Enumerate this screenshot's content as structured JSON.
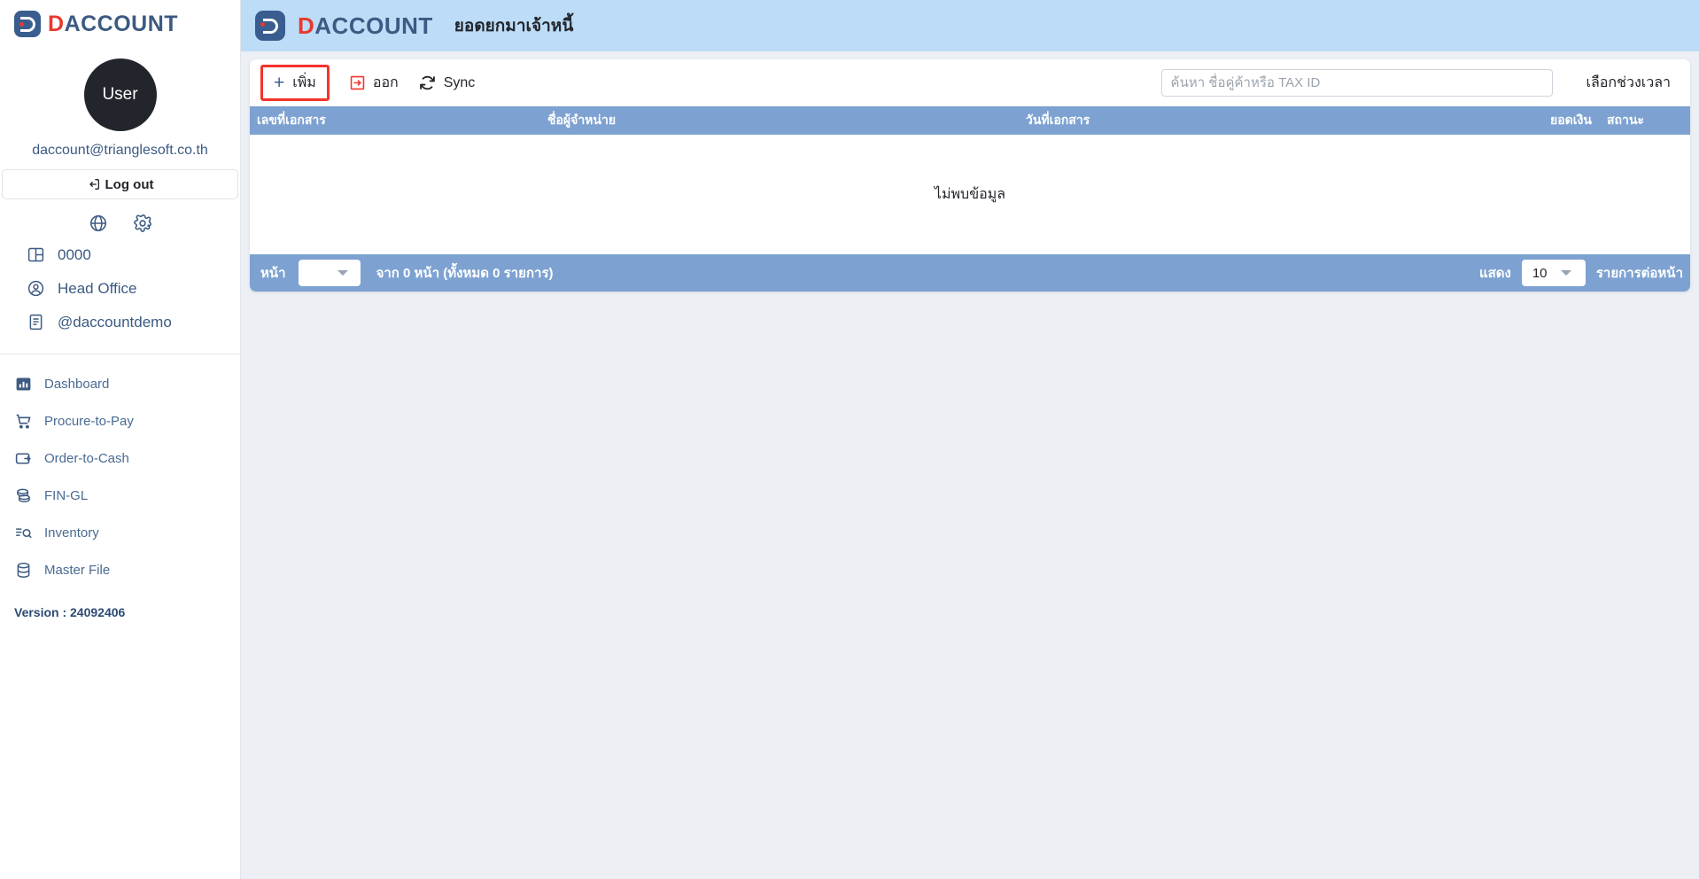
{
  "brand": {
    "name_prefix": "D",
    "name_rest": "ACCOUNT",
    "logo_icon": "daccount-logo-icon"
  },
  "sidebar": {
    "avatar_label": "User",
    "email": "daccount@trianglesoft.co.th",
    "logout_label": "Log out",
    "quick_icons": [
      {
        "name": "globe-icon",
        "label": "globe"
      },
      {
        "name": "gear-icon",
        "label": "settings"
      }
    ],
    "context_items": [
      {
        "label": "0000",
        "icon": "company-panel-icon"
      },
      {
        "label": "Head Office",
        "icon": "user-circle-icon"
      },
      {
        "label": "@daccountdemo",
        "icon": "document-icon"
      }
    ],
    "nav_items": [
      {
        "label": "Dashboard",
        "icon": "chart-bar-icon"
      },
      {
        "label": "Procure-to-Pay",
        "icon": "shopping-cart-icon"
      },
      {
        "label": "Order-to-Cash",
        "icon": "wallet-arrow-icon"
      },
      {
        "label": "FIN-GL",
        "icon": "coins-stack-icon"
      },
      {
        "label": "Inventory",
        "icon": "list-search-icon"
      },
      {
        "label": "Master File",
        "icon": "database-icon"
      }
    ],
    "version": "Version : 24092406"
  },
  "header": {
    "page_title": "ยอดยกมาเจ้าหนี้"
  },
  "toolbar": {
    "add_label": "เพิ่ม",
    "add_icon": "plus-icon",
    "export_label": "ออก",
    "export_icon": "export-box-arrow-icon",
    "sync_label": "Sync",
    "sync_icon": "refresh-sync-icon",
    "search_placeholder": "ค้นหา ชื่อคู่ค้าหรือ TAX ID",
    "search_value": "",
    "daterange_label": "เลือกช่วงเวลา"
  },
  "table": {
    "columns": [
      {
        "key": "doc_no",
        "label": "เลขที่เอกสาร"
      },
      {
        "key": "vendor",
        "label": "ชื่อผู้จำหน่าย"
      },
      {
        "key": "doc_date",
        "label": "วันที่เอกสาร"
      },
      {
        "key": "amount",
        "label": "ยอดเงิน"
      },
      {
        "key": "status",
        "label": "สถานะ"
      }
    ],
    "rows": [],
    "empty_message": "ไม่พบข้อมูล"
  },
  "pagination": {
    "page_label": "หน้า",
    "page_value": "",
    "of_pages_text": "จาก 0 หน้า (ทั้งหมด 0 รายการ)",
    "show_label": "แสดง",
    "rows_per_page": "10",
    "rows_suffix_label": "รายการต่อหน้า"
  },
  "colors": {
    "brand_blue": "#3c5a82",
    "brand_red": "#e8392e",
    "topbar_blue": "#bcdcf7",
    "table_header_blue": "#7da2d1",
    "page_bg": "#eceff4",
    "highlight_red": "#f5342b"
  }
}
